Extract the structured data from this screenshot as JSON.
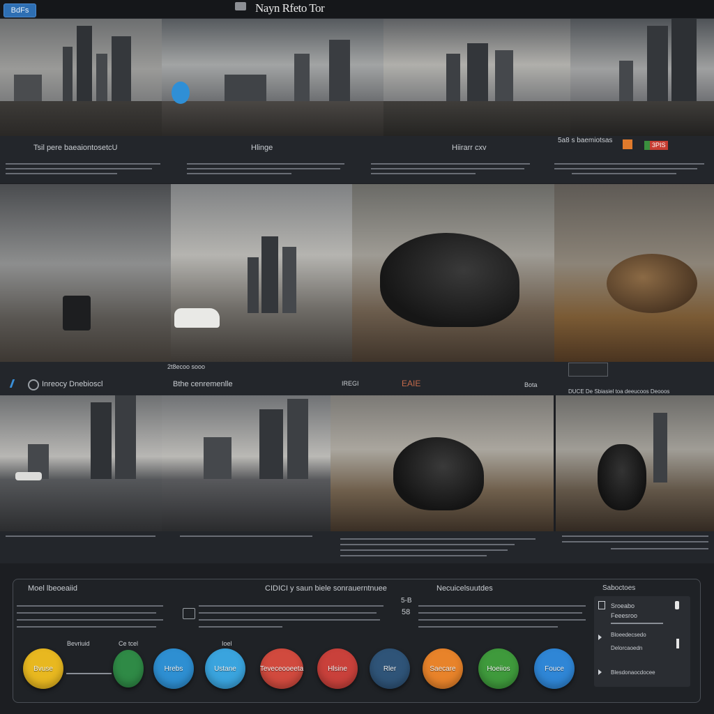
{
  "topbar": {
    "button_label": "BdFs",
    "title": "Nayn Rfeto Tor"
  },
  "row1": {
    "captions": [
      "Tsil pere baeaiontosetcU",
      "Hlinge",
      "Hiirarr cxv",
      "5a8 s baemiotsas"
    ],
    "badge": "3PIS"
  },
  "row2": {
    "label_small": "2t8ecoo sooo",
    "captions": [
      "Inreocy Dnebioscl",
      "Bthe cenremenlle",
      "IREGI",
      "EAIE",
      "Bota"
    ],
    "right_caption": "DUCE De Sbiasiel toa deeucoos Deooos"
  },
  "panel": {
    "header_left": "Moel lbeoeaiid",
    "header_mid": "CIDICI y saun biele sonrauerntnuee",
    "header_right": "Necuicelsuutdes",
    "header_far": "Saboctoes",
    "mini_label_a": "Bevriuid",
    "mini_label_b": "Ce tcel",
    "mini_label_c": "Ioel",
    "num_a": "5-B",
    "num_b": "58",
    "pills": [
      {
        "label": "Bvuse",
        "color": "#e8b820"
      },
      {
        "label": "",
        "color": "#2f8a46"
      },
      {
        "label": "Hrebs",
        "color": "#2e8fd2"
      },
      {
        "label": "Ustane",
        "color": "#3aa4de"
      },
      {
        "label": "Teveceooeeta",
        "color": "#d14a3e"
      },
      {
        "label": "Hlsine",
        "color": "#c9413b"
      },
      {
        "label": "Rler",
        "color": "#2f5478"
      },
      {
        "label": "Saecare",
        "color": "#e8832a"
      },
      {
        "label": "Hoeiios",
        "color": "#3f9a3c"
      },
      {
        "label": "Fouce",
        "color": "#2f86d6"
      }
    ],
    "side": {
      "item1": "Sroeabo",
      "item2": "Feeesroo",
      "item3": "Bloeedecsedo",
      "item4": "Delorcaoedn",
      "item5": "Blesdonaocdocee"
    }
  },
  "colors": {
    "accent": "#2e6fb3",
    "background": "#1c1e22"
  }
}
